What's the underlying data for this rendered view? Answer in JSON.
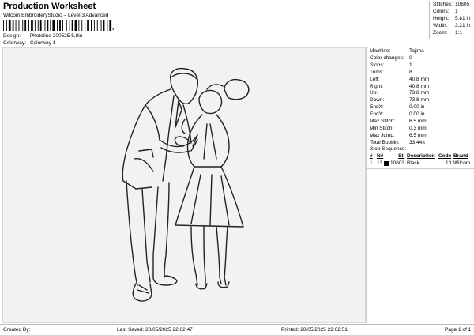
{
  "header": {
    "title": "Production Worksheet",
    "subtitle": "Wilcom EmbroideryStudio – Level 3 Advanced",
    "barcode_suffix": ","
  },
  "meta": {
    "design_label": "Design:",
    "design_value": "Photoline 200525 5,8in",
    "colorway_label": "Colorway:",
    "colorway_value": "Colorway 1"
  },
  "summary": {
    "stitches_label": "Stitches:",
    "stitches_value": "10605",
    "colors_label": "Colors:",
    "colors_value": "1",
    "height_label": "Height:",
    "height_value": "5.81 in",
    "width_label": "Width:",
    "width_value": "3.21 in",
    "zoom_label": "Zoom:",
    "zoom_value": "1:1"
  },
  "params": [
    {
      "label": "Machine:",
      "value": "Tajima"
    },
    {
      "label": "Color changes:",
      "value": "0"
    },
    {
      "label": "Stops:",
      "value": "1"
    },
    {
      "label": "Trims:",
      "value": "8"
    },
    {
      "label": "Left:",
      "value": "40.8 mm"
    },
    {
      "label": "Right:",
      "value": "40.8 mm"
    },
    {
      "label": "Up:",
      "value": "73.8 mm"
    },
    {
      "label": "Down:",
      "value": "73.8 mm"
    },
    {
      "label": "EndX:",
      "value": "0.00 in"
    },
    {
      "label": "EndY:",
      "value": "0.00 in"
    },
    {
      "label": "Max Stitch:",
      "value": "6.5 mm"
    },
    {
      "label": "Min Stitch:",
      "value": "0.3 mm"
    },
    {
      "label": "Max Jump:",
      "value": "6.5 mm"
    },
    {
      "label": "Total Bobbin:",
      "value": "33.44ft"
    }
  ],
  "stop_sequence": {
    "title": "Stop Sequence:",
    "headers": {
      "num": "#",
      "n": "N#",
      "st": "St.",
      "desc": "Description",
      "code": "Code",
      "brand": "Brand"
    },
    "rows": [
      {
        "num": "1",
        "n": "13",
        "swatch_color": "#000000",
        "st": "10603",
        "desc": "Black",
        "code": "13",
        "brand": "Wilcom"
      }
    ]
  },
  "footer": {
    "created": "Created By:",
    "last_saved": "Last Saved: 20/05/2025 22:02:47",
    "printed": "Printed: 20/05/2025 22:02:51",
    "page": "Page 1 of 1"
  }
}
